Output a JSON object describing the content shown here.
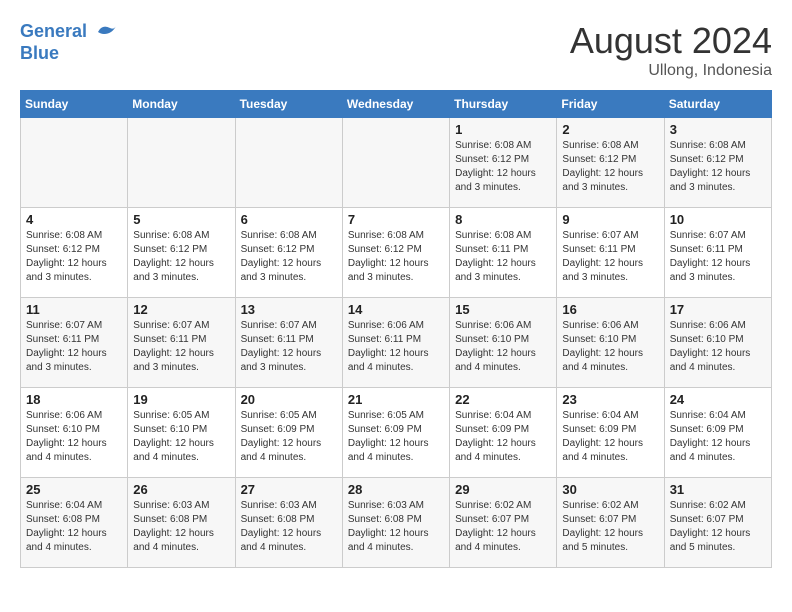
{
  "header": {
    "logo_line1": "General",
    "logo_line2": "Blue",
    "month_year": "August 2024",
    "location": "Ullong, Indonesia"
  },
  "days_of_week": [
    "Sunday",
    "Monday",
    "Tuesday",
    "Wednesday",
    "Thursday",
    "Friday",
    "Saturday"
  ],
  "weeks": [
    [
      {
        "num": "",
        "info": ""
      },
      {
        "num": "",
        "info": ""
      },
      {
        "num": "",
        "info": ""
      },
      {
        "num": "",
        "info": ""
      },
      {
        "num": "1",
        "info": "Sunrise: 6:08 AM\nSunset: 6:12 PM\nDaylight: 12 hours\nand 3 minutes."
      },
      {
        "num": "2",
        "info": "Sunrise: 6:08 AM\nSunset: 6:12 PM\nDaylight: 12 hours\nand 3 minutes."
      },
      {
        "num": "3",
        "info": "Sunrise: 6:08 AM\nSunset: 6:12 PM\nDaylight: 12 hours\nand 3 minutes."
      }
    ],
    [
      {
        "num": "4",
        "info": "Sunrise: 6:08 AM\nSunset: 6:12 PM\nDaylight: 12 hours\nand 3 minutes."
      },
      {
        "num": "5",
        "info": "Sunrise: 6:08 AM\nSunset: 6:12 PM\nDaylight: 12 hours\nand 3 minutes."
      },
      {
        "num": "6",
        "info": "Sunrise: 6:08 AM\nSunset: 6:12 PM\nDaylight: 12 hours\nand 3 minutes."
      },
      {
        "num": "7",
        "info": "Sunrise: 6:08 AM\nSunset: 6:12 PM\nDaylight: 12 hours\nand 3 minutes."
      },
      {
        "num": "8",
        "info": "Sunrise: 6:08 AM\nSunset: 6:11 PM\nDaylight: 12 hours\nand 3 minutes."
      },
      {
        "num": "9",
        "info": "Sunrise: 6:07 AM\nSunset: 6:11 PM\nDaylight: 12 hours\nand 3 minutes."
      },
      {
        "num": "10",
        "info": "Sunrise: 6:07 AM\nSunset: 6:11 PM\nDaylight: 12 hours\nand 3 minutes."
      }
    ],
    [
      {
        "num": "11",
        "info": "Sunrise: 6:07 AM\nSunset: 6:11 PM\nDaylight: 12 hours\nand 3 minutes."
      },
      {
        "num": "12",
        "info": "Sunrise: 6:07 AM\nSunset: 6:11 PM\nDaylight: 12 hours\nand 3 minutes."
      },
      {
        "num": "13",
        "info": "Sunrise: 6:07 AM\nSunset: 6:11 PM\nDaylight: 12 hours\nand 3 minutes."
      },
      {
        "num": "14",
        "info": "Sunrise: 6:06 AM\nSunset: 6:11 PM\nDaylight: 12 hours\nand 4 minutes."
      },
      {
        "num": "15",
        "info": "Sunrise: 6:06 AM\nSunset: 6:10 PM\nDaylight: 12 hours\nand 4 minutes."
      },
      {
        "num": "16",
        "info": "Sunrise: 6:06 AM\nSunset: 6:10 PM\nDaylight: 12 hours\nand 4 minutes."
      },
      {
        "num": "17",
        "info": "Sunrise: 6:06 AM\nSunset: 6:10 PM\nDaylight: 12 hours\nand 4 minutes."
      }
    ],
    [
      {
        "num": "18",
        "info": "Sunrise: 6:06 AM\nSunset: 6:10 PM\nDaylight: 12 hours\nand 4 minutes."
      },
      {
        "num": "19",
        "info": "Sunrise: 6:05 AM\nSunset: 6:10 PM\nDaylight: 12 hours\nand 4 minutes."
      },
      {
        "num": "20",
        "info": "Sunrise: 6:05 AM\nSunset: 6:09 PM\nDaylight: 12 hours\nand 4 minutes."
      },
      {
        "num": "21",
        "info": "Sunrise: 6:05 AM\nSunset: 6:09 PM\nDaylight: 12 hours\nand 4 minutes."
      },
      {
        "num": "22",
        "info": "Sunrise: 6:04 AM\nSunset: 6:09 PM\nDaylight: 12 hours\nand 4 minutes."
      },
      {
        "num": "23",
        "info": "Sunrise: 6:04 AM\nSunset: 6:09 PM\nDaylight: 12 hours\nand 4 minutes."
      },
      {
        "num": "24",
        "info": "Sunrise: 6:04 AM\nSunset: 6:09 PM\nDaylight: 12 hours\nand 4 minutes."
      }
    ],
    [
      {
        "num": "25",
        "info": "Sunrise: 6:04 AM\nSunset: 6:08 PM\nDaylight: 12 hours\nand 4 minutes."
      },
      {
        "num": "26",
        "info": "Sunrise: 6:03 AM\nSunset: 6:08 PM\nDaylight: 12 hours\nand 4 minutes."
      },
      {
        "num": "27",
        "info": "Sunrise: 6:03 AM\nSunset: 6:08 PM\nDaylight: 12 hours\nand 4 minutes."
      },
      {
        "num": "28",
        "info": "Sunrise: 6:03 AM\nSunset: 6:08 PM\nDaylight: 12 hours\nand 4 minutes."
      },
      {
        "num": "29",
        "info": "Sunrise: 6:02 AM\nSunset: 6:07 PM\nDaylight: 12 hours\nand 4 minutes."
      },
      {
        "num": "30",
        "info": "Sunrise: 6:02 AM\nSunset: 6:07 PM\nDaylight: 12 hours\nand 5 minutes."
      },
      {
        "num": "31",
        "info": "Sunrise: 6:02 AM\nSunset: 6:07 PM\nDaylight: 12 hours\nand 5 minutes."
      }
    ]
  ]
}
